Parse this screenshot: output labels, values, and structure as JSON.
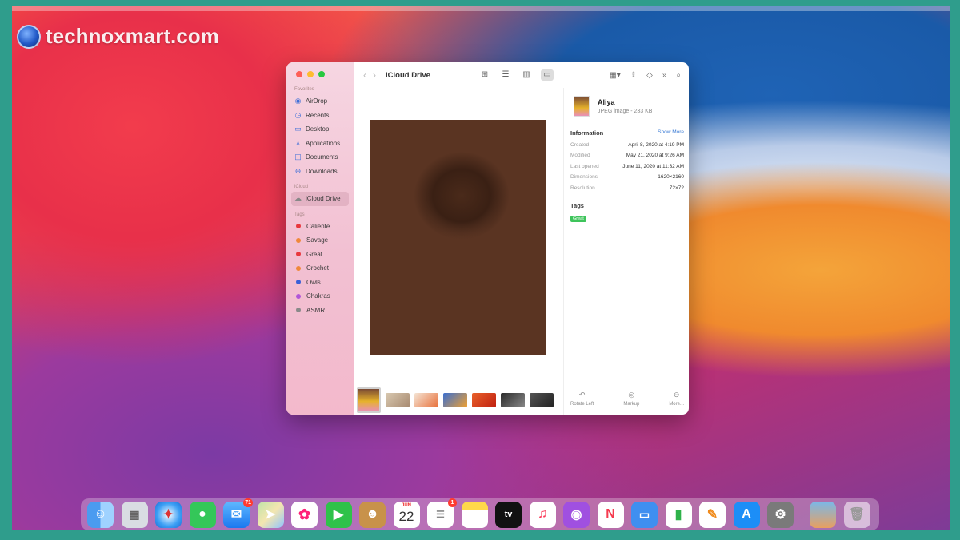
{
  "watermark": {
    "text": "technoxmart.com"
  },
  "finder": {
    "title": "iCloud Drive",
    "sidebar": {
      "favorites_title": "Favorites",
      "favorites": [
        {
          "label": "AirDrop",
          "icon": "airdrop-icon"
        },
        {
          "label": "Recents",
          "icon": "clock-icon"
        },
        {
          "label": "Desktop",
          "icon": "desktop-icon"
        },
        {
          "label": "Applications",
          "icon": "applications-icon"
        },
        {
          "label": "Documents",
          "icon": "document-icon"
        },
        {
          "label": "Downloads",
          "icon": "download-icon"
        }
      ],
      "icloud_title": "iCloud",
      "icloud": [
        {
          "label": "iCloud Drive",
          "icon": "cloud-icon"
        }
      ],
      "tags_title": "Tags",
      "tags": [
        {
          "label": "Caliente",
          "color": "#e8383d"
        },
        {
          "label": "Savage",
          "color": "#f0883a"
        },
        {
          "label": "Great",
          "color": "#e8383d"
        },
        {
          "label": "Crochet",
          "color": "#f0883a"
        },
        {
          "label": "Owls",
          "color": "#3a5fd8"
        },
        {
          "label": "Chakras",
          "color": "#b055d8"
        },
        {
          "label": "ASMR",
          "color": "#8a8a8a"
        }
      ]
    },
    "info": {
      "name": "Aliya",
      "kind": "JPEG image - 233 KB",
      "section": "Information",
      "show_more": "Show More",
      "rows": [
        {
          "k": "Created",
          "v": "April 8, 2020 at 4:19 PM"
        },
        {
          "k": "Modified",
          "v": "May 21, 2020 at 9:26 AM"
        },
        {
          "k": "Last opened",
          "v": "June 11, 2020 at 11:32 AM"
        },
        {
          "k": "Dimensions",
          "v": "1620×2160"
        },
        {
          "k": "Resolution",
          "v": "72×72"
        }
      ],
      "tags_title": "Tags",
      "tag": "Great",
      "actions": [
        {
          "label": "Rotate Left",
          "icon": "rotate-left-icon"
        },
        {
          "label": "Markup",
          "icon": "markup-icon"
        },
        {
          "label": "More...",
          "icon": "more-icon"
        }
      ]
    }
  },
  "dock": {
    "calendar_month": "JUN",
    "calendar_day": "22",
    "mail_badge": "71",
    "reminders_badge": "1",
    "tv_label": "tv"
  }
}
